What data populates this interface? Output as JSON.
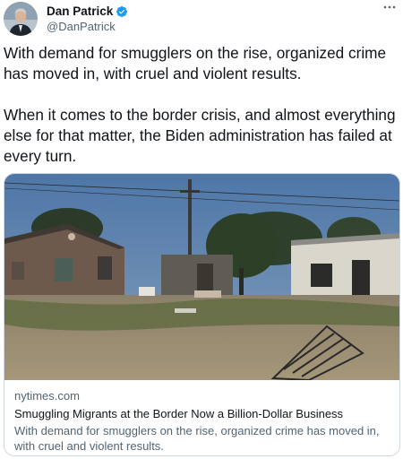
{
  "author": {
    "display_name": "Dan Patrick",
    "handle": "@DanPatrick",
    "verified": true,
    "avatar_icon": "avatar-icon",
    "verified_icon": "verified-badge-icon"
  },
  "menu": {
    "icon": "more-options-icon"
  },
  "tweet": {
    "paragraphs": [
      "With demand for smugglers on the rise, organized crime has moved in, with cruel and violent results.",
      "When it comes to the border crisis, and almost everything else for that matter, the Biden administration has failed at every turn."
    ]
  },
  "link_card": {
    "domain": "nytimes.com",
    "title": "Smuggling Migrants at the Border Now a Billion-Dollar Business",
    "description": "With demand for smugglers on the rise, organized crime has moved in, with cruel and violent results.",
    "image_icon": "article-photo-image"
  },
  "colors": {
    "text_primary": "#0f1419",
    "text_secondary": "#536471",
    "verified_blue": "#1d9bf0",
    "card_border": "#cfd9de"
  }
}
